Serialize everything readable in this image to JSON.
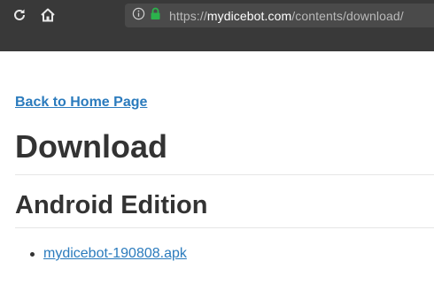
{
  "browser": {
    "url_scheme": "https://",
    "url_host": "mydicebot.com",
    "url_path": "/contents/download/"
  },
  "page": {
    "back_link": "Back to Home Page",
    "title": "Download",
    "section_title": "Android Edition",
    "files": [
      {
        "label": "mydicebot-190808.apk"
      }
    ]
  },
  "colors": {
    "toolbar_bg": "#393939",
    "link": "#2b7bbd",
    "heading": "#333333",
    "lock": "#2bb24c"
  },
  "icons": [
    "reload-icon",
    "home-icon",
    "info-icon",
    "lock-icon"
  ]
}
